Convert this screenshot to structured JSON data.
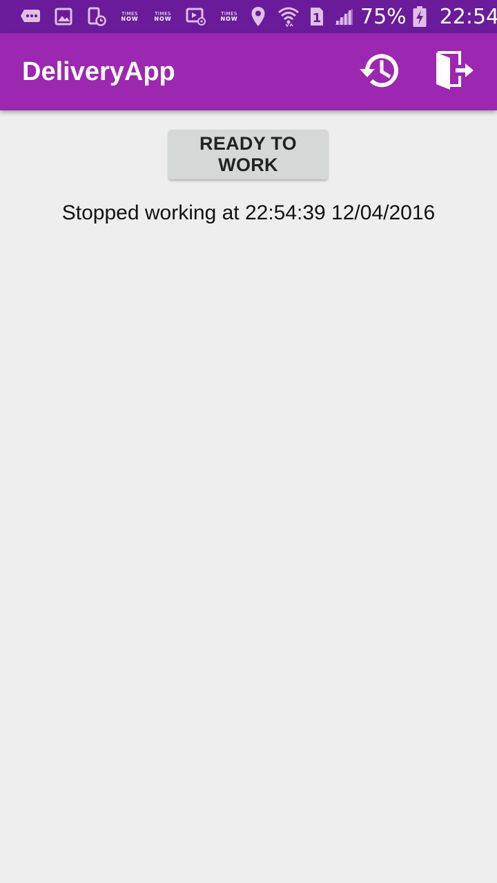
{
  "status_bar": {
    "icons": [
      "message-icon",
      "image-icon",
      "phone-schedule-icon",
      "times-now-icon",
      "times-now-icon",
      "email-video-icon",
      "times-now-icon",
      "location-icon",
      "wifi-icon",
      "sim-1-icon",
      "signal-icon",
      "battery-charging-icon"
    ],
    "times_now_line1": "TIMES",
    "times_now_line2": "NOW",
    "sim_label": "1",
    "battery_percent": "75%",
    "time": "22:54",
    "background_color": "#6a1b9a"
  },
  "app_bar": {
    "title": "DeliveryApp",
    "background_color": "#9c27b0",
    "actions": [
      "history-icon",
      "logout-icon"
    ]
  },
  "main": {
    "ready_button_label": "READY TO WORK",
    "status_message": "Stopped working at 22:54:39 12/04/2016",
    "background_color": "#eeeeee"
  }
}
